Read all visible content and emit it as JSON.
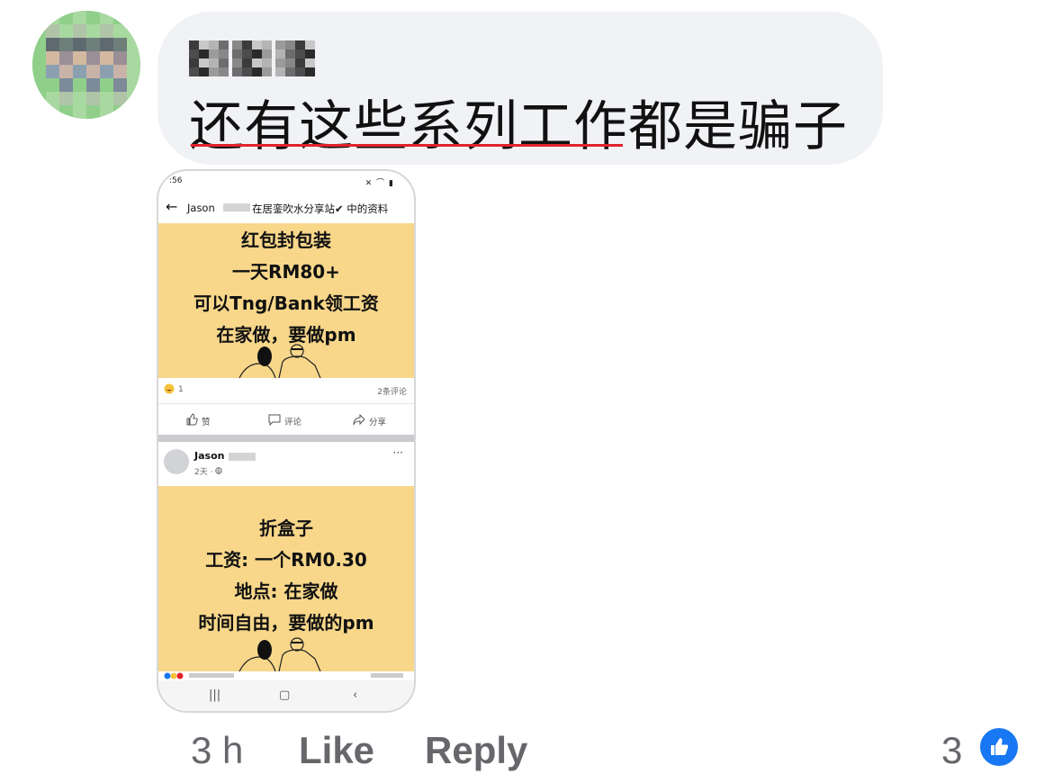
{
  "comment": {
    "text": "还有这些系列工作都是骗子",
    "colors": {
      "bubble": "#f0f2f5",
      "underline": "#e0232b"
    }
  },
  "screenshot": {
    "status": {
      "time": ":56",
      "icons": "✕ ⌒ ▮"
    },
    "appbar": {
      "back": "←",
      "name": "Jason",
      "group": "在居銮吹水分享站✔ 中的资料"
    },
    "post1": {
      "lines": [
        "红包封包装",
        "一天RM80+",
        "可以Tng/Bank领工资",
        "在家做，要做pm"
      ],
      "reaction_count": "1",
      "comments": "2条评论"
    },
    "actions": {
      "like": "赞",
      "comment": "评论",
      "share": "分享"
    },
    "post2": {
      "author": "Jason",
      "meta": "2天 · ",
      "more": "···",
      "lines": [
        "折盒子",
        "工资: 一个RM0.30",
        "地点: 在家做",
        "时间自由，要做的pm"
      ]
    },
    "card_color": "#f8d78a"
  },
  "footer": {
    "time": "3 h",
    "like": "Like",
    "reply": "Reply",
    "like_count": "3",
    "accent": "#1877f2"
  }
}
